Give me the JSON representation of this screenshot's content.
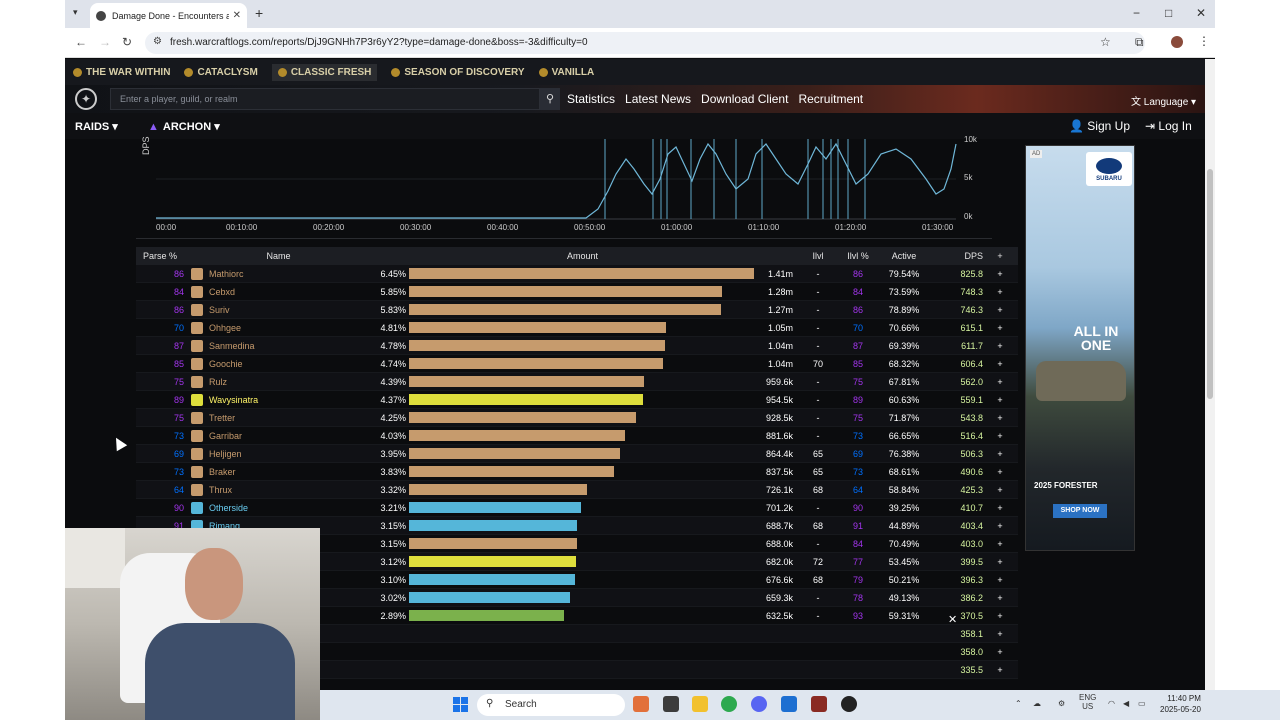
{
  "browser": {
    "tab_title": "Damage Done - Encounters an",
    "new_tab": "+",
    "url": "fresh.warcraftlogs.com/reports/DjJ9GNHh7P3r6yY2?type=damage-done&boss=-3&difficulty=0",
    "window_controls": [
      "−",
      "□",
      "✕"
    ]
  },
  "site": {
    "expansions": [
      {
        "label": "THE WAR WITHIN",
        "active": false
      },
      {
        "label": "CATACLYSM",
        "active": false
      },
      {
        "label": "CLASSIC FRESH",
        "active": true
      },
      {
        "label": "SEASON OF DISCOVERY",
        "active": false
      },
      {
        "label": "VANILLA",
        "active": false
      }
    ],
    "search_placeholder": "Enter a player, guild, or realm",
    "nav": [
      "Statistics",
      "Latest News",
      "Download Client",
      "Recruitment"
    ],
    "language": "Language",
    "raids": "RAIDS",
    "archon": "ARCHON",
    "sign_up": "Sign Up",
    "log_in": "Log In"
  },
  "graph": {
    "ylabel": "DPS",
    "yticks": [
      "10k",
      "5k",
      "0k"
    ],
    "xticks": [
      "00:00",
      "00:10:00",
      "00:20:00",
      "00:30:00",
      "00:40:00",
      "00:50:00",
      "01:00:00",
      "01:10:00",
      "01:20:00",
      "01:30:00"
    ]
  },
  "table": {
    "headers": {
      "parse": "Parse %",
      "name": "Name",
      "amount": "Amount",
      "ilvl": "Ilvl",
      "ilvl_pct": "Ilvl %",
      "active": "Active",
      "dps": "DPS",
      "plus": "+"
    },
    "rows": [
      {
        "parse": "86",
        "name": "Mathiorc",
        "pct": "6.45%",
        "bar": 1.0,
        "amount": "1.41m",
        "ilvl": "-",
        "ilvl_pct": "86",
        "active": "79.54%",
        "dps": "825.8",
        "color": "#c69b6d",
        "name_color": "#c69b6d"
      },
      {
        "parse": "84",
        "name": "Cebxd",
        "pct": "5.85%",
        "bar": 0.907,
        "amount": "1.28m",
        "ilvl": "-",
        "ilvl_pct": "84",
        "active": "73.59%",
        "dps": "748.3",
        "color": "#c69b6d",
        "name_color": "#c69b6d"
      },
      {
        "parse": "86",
        "name": "Suriv",
        "pct": "5.83%",
        "bar": 0.904,
        "amount": "1.27m",
        "ilvl": "-",
        "ilvl_pct": "86",
        "active": "78.89%",
        "dps": "746.3",
        "color": "#c69b6d",
        "name_color": "#c69b6d"
      },
      {
        "parse": "70",
        "name": "Ohhgee",
        "pct": "4.81%",
        "bar": 0.746,
        "amount": "1.05m",
        "ilvl": "-",
        "ilvl_pct": "70",
        "active": "70.66%",
        "dps": "615.1",
        "color": "#c69b6d",
        "name_color": "#c69b6d"
      },
      {
        "parse": "87",
        "name": "Sanmedina",
        "pct": "4.78%",
        "bar": 0.741,
        "amount": "1.04m",
        "ilvl": "-",
        "ilvl_pct": "87",
        "active": "69.39%",
        "dps": "611.7",
        "color": "#c69b6d",
        "name_color": "#c69b6d"
      },
      {
        "parse": "85",
        "name": "Goochie",
        "pct": "4.74%",
        "bar": 0.735,
        "amount": "1.04m",
        "ilvl": "70",
        "ilvl_pct": "85",
        "active": "68.32%",
        "dps": "606.4",
        "color": "#c69b6d",
        "name_color": "#c69b6d"
      },
      {
        "parse": "75",
        "name": "Rulz",
        "pct": "4.39%",
        "bar": 0.681,
        "amount": "959.6k",
        "ilvl": "-",
        "ilvl_pct": "75",
        "active": "67.81%",
        "dps": "562.0",
        "color": "#c69b6d",
        "name_color": "#c69b6d"
      },
      {
        "parse": "89",
        "name": "Wavysinatra",
        "pct": "4.37%",
        "bar": 0.677,
        "amount": "954.5k",
        "ilvl": "-",
        "ilvl_pct": "89",
        "active": "60.63%",
        "dps": "559.1",
        "color": "#dede3c",
        "name_color": "#fff468"
      },
      {
        "parse": "75",
        "name": "Tretter",
        "pct": "4.25%",
        "bar": 0.659,
        "amount": "928.5k",
        "ilvl": "-",
        "ilvl_pct": "75",
        "active": "71.87%",
        "dps": "543.8",
        "color": "#c69b6d",
        "name_color": "#c69b6d"
      },
      {
        "parse": "73",
        "name": "Garribar",
        "pct": "4.03%",
        "bar": 0.625,
        "amount": "881.6k",
        "ilvl": "-",
        "ilvl_pct": "73",
        "active": "66.65%",
        "dps": "516.4",
        "color": "#c69b6d",
        "name_color": "#c69b6d"
      },
      {
        "parse": "69",
        "name": "Heljigen",
        "pct": "3.95%",
        "bar": 0.612,
        "amount": "864.4k",
        "ilvl": "65",
        "ilvl_pct": "69",
        "active": "76.38%",
        "dps": "506.3",
        "color": "#c69b6d",
        "name_color": "#c69b6d"
      },
      {
        "parse": "73",
        "name": "Braker",
        "pct": "3.83%",
        "bar": 0.594,
        "amount": "837.5k",
        "ilvl": "65",
        "ilvl_pct": "73",
        "active": "68.61%",
        "dps": "490.6",
        "color": "#c69b6d",
        "name_color": "#c69b6d"
      },
      {
        "parse": "64",
        "name": "Thrux",
        "pct": "3.32%",
        "bar": 0.515,
        "amount": "726.1k",
        "ilvl": "68",
        "ilvl_pct": "64",
        "active": "58.84%",
        "dps": "425.3",
        "color": "#c69b6d",
        "name_color": "#c69b6d"
      },
      {
        "parse": "90",
        "name": "Otherside",
        "pct": "3.21%",
        "bar": 0.498,
        "amount": "701.2k",
        "ilvl": "-",
        "ilvl_pct": "90",
        "active": "39.25%",
        "dps": "410.7",
        "color": "#55b6d9",
        "name_color": "#69ccf0"
      },
      {
        "parse": "91",
        "name": "Rimang",
        "pct": "3.15%",
        "bar": 0.488,
        "amount": "688.7k",
        "ilvl": "68",
        "ilvl_pct": "91",
        "active": "44.89%",
        "dps": "403.4",
        "color": "#55b6d9",
        "name_color": "#69ccf0"
      },
      {
        "parse": "",
        "name": "",
        "pct": "3.15%",
        "bar": 0.488,
        "amount": "688.0k",
        "ilvl": "-",
        "ilvl_pct": "84",
        "active": "70.49%",
        "dps": "403.0",
        "color": "#c69b6d",
        "name_color": "#c69b6d"
      },
      {
        "parse": "",
        "name": "",
        "pct": "3.12%",
        "bar": 0.484,
        "amount": "682.0k",
        "ilvl": "72",
        "ilvl_pct": "77",
        "active": "53.45%",
        "dps": "399.5",
        "color": "#dede3c",
        "name_color": "#fff468"
      },
      {
        "parse": "",
        "name": "",
        "pct": "3.10%",
        "bar": 0.481,
        "amount": "676.6k",
        "ilvl": "68",
        "ilvl_pct": "79",
        "active": "50.21%",
        "dps": "396.3",
        "color": "#55b6d9",
        "name_color": "#69ccf0"
      },
      {
        "parse": "",
        "name": "",
        "pct": "3.02%",
        "bar": 0.468,
        "amount": "659.3k",
        "ilvl": "-",
        "ilvl_pct": "78",
        "active": "49.13%",
        "dps": "386.2",
        "color": "#55b6d9",
        "name_color": "#69ccf0"
      },
      {
        "parse": "",
        "name": "",
        "pct": "2.89%",
        "bar": 0.448,
        "amount": "632.5k",
        "ilvl": "-",
        "ilvl_pct": "93",
        "active": "59.31%",
        "dps": "370.5",
        "color": "#7bb14c",
        "name_color": "#abd473"
      },
      {
        "parse": "",
        "name": "",
        "pct": "",
        "bar": 0,
        "amount": "",
        "ilvl": "",
        "ilvl_pct": "",
        "active": "",
        "dps": "358.1",
        "color": "#c69b6d",
        "name_color": "#c69b6d"
      },
      {
        "parse": "",
        "name": "",
        "pct": "",
        "bar": 0,
        "amount": "",
        "ilvl": "",
        "ilvl_pct": "",
        "active": "",
        "dps": "358.0",
        "color": "#c69b6d",
        "name_color": "#c69b6d"
      },
      {
        "parse": "",
        "name": "",
        "pct": "",
        "bar": 0,
        "amount": "",
        "ilvl": "",
        "ilvl_pct": "",
        "active": "",
        "dps": "335.5",
        "color": "#c69b6d",
        "name_color": "#c69b6d"
      }
    ]
  },
  "ad": {
    "tag": "AD",
    "brand": "SUBARU",
    "headline": "ALL IN ONE",
    "model": "2025 FORESTER",
    "cta": "SHOP NOW"
  },
  "taskbar": {
    "search": "Search",
    "lang_top": "ENG",
    "lang_bottom": "US",
    "time": "11:40 PM",
    "date": "2025-05-20"
  },
  "colors": {
    "parse_purple": "#a335ee",
    "parse_blue": "#0070ff",
    "dps_green": "#d7f5a0"
  }
}
